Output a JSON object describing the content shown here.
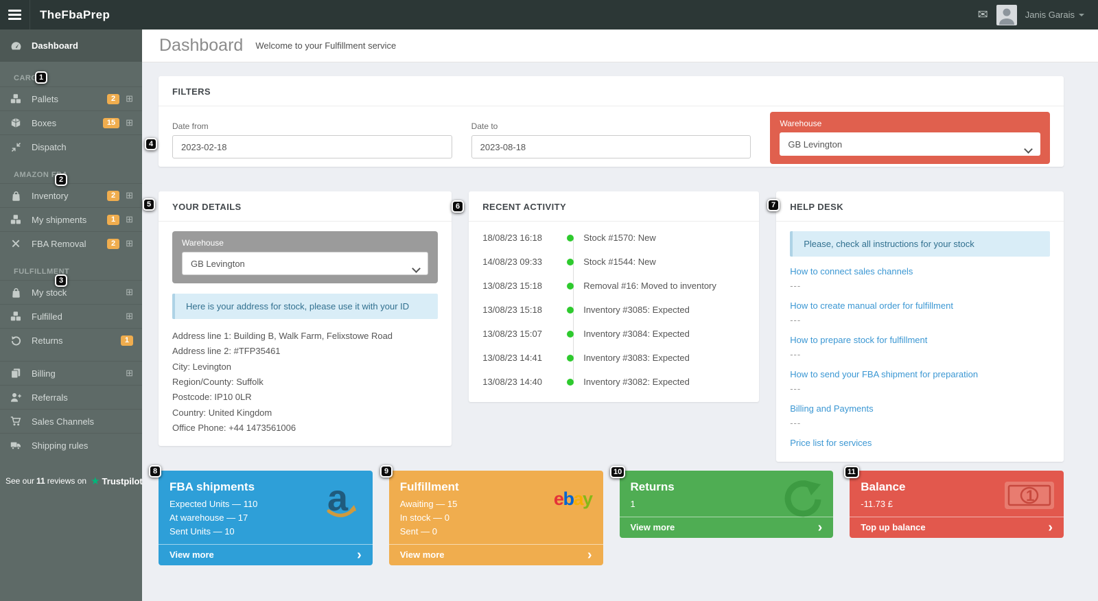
{
  "topbar": {
    "logo": "TheFbaPrep",
    "user_name": "Janis Garais"
  },
  "sidebar": {
    "dashboard_label": "Dashboard",
    "sections": [
      {
        "label": "CARGO",
        "items": [
          {
            "label": "Pallets",
            "badge": "2",
            "expand": "⊞"
          },
          {
            "label": "Boxes",
            "badge": "15",
            "expand": "⊞"
          },
          {
            "label": "Dispatch"
          }
        ]
      },
      {
        "label": "AMAZON FBA",
        "items": [
          {
            "label": "Inventory",
            "badge": "2",
            "expand": "⊞"
          },
          {
            "label": "My shipments",
            "badge": "1",
            "expand": "⊞"
          },
          {
            "label": "FBA Removal",
            "badge": "2",
            "expand": "⊞"
          }
        ]
      },
      {
        "label": "FULFILLMENT",
        "items": [
          {
            "label": "My stock",
            "expand": "⊞"
          },
          {
            "label": "Fulfilled",
            "expand": "⊞"
          },
          {
            "label": "Returns",
            "badge": "1"
          }
        ]
      },
      {
        "label": "",
        "items": [
          {
            "label": "Billing",
            "expand": "⊞"
          },
          {
            "label": "Referrals"
          },
          {
            "label": "Sales Channels"
          },
          {
            "label": "Shipping rules"
          }
        ]
      }
    ],
    "trustpilot_prefix": "See our",
    "trustpilot_count": "11",
    "trustpilot_suffix": "reviews on",
    "trustpilot_brand": "Trustpilot",
    "trustpilot_star": "★"
  },
  "page_header": {
    "title": "Dashboard",
    "subtitle": "Welcome to your Fulfillment service"
  },
  "filters": {
    "title": "FILTERS",
    "date_from_label": "Date from",
    "date_from_value": "2023-02-18",
    "date_to_label": "Date to",
    "date_to_value": "2023-08-18",
    "warehouse_label": "Warehouse",
    "warehouse_value": "GB Levington"
  },
  "your_details": {
    "title": "YOUR DETAILS",
    "warehouse_label": "Warehouse",
    "warehouse_value": "GB Levington",
    "alert": "Here is your address for stock, please use it with your ID",
    "address_lines": [
      "Address line 1: Building B, Walk Farm, Felixstowe Road",
      "Address line 2: #TFP35461",
      "City: Levington",
      "Region/County: Suffolk",
      "Postcode: IP10 0LR",
      "Country: United Kingdom",
      "Office Phone: +44 1473561006"
    ]
  },
  "recent_activity": {
    "title": "RECENT ACTIVITY",
    "events": [
      {
        "time": "18/08/23 16:18",
        "text": "Stock #1570: New"
      },
      {
        "time": "14/08/23 09:33",
        "text": "Stock #1544: New"
      },
      {
        "time": "13/08/23 15:18",
        "text": "Removal #16: Moved to inventory"
      },
      {
        "time": "13/08/23 15:18",
        "text": "Inventory #3085: Expected"
      },
      {
        "time": "13/08/23 15:07",
        "text": "Inventory #3084: Expected"
      },
      {
        "time": "13/08/23 14:41",
        "text": "Inventory #3083: Expected"
      },
      {
        "time": "13/08/23 14:40",
        "text": "Inventory #3082: Expected"
      }
    ]
  },
  "help_desk": {
    "title": "HELP DESK",
    "alert": "Please, check all instructions for your stock",
    "separator": "---",
    "links": [
      "How to connect sales channels",
      "How to create manual order for fulfillment",
      "How to prepare stock for fulfillment",
      "How to send your FBA shipment for preparation",
      "Billing and Payments",
      "Price list for services"
    ]
  },
  "cards": [
    {
      "title": "FBA shipments",
      "color": "#2e9fd8",
      "logo": "amazon",
      "lines": [
        "Expected Units — 110",
        "At warehouse — 17",
        "Sent Units — 10"
      ],
      "footer": "View more"
    },
    {
      "title": "Fulfillment",
      "color": "#f0ad4e",
      "logo": "ebay",
      "lines": [
        "Awaiting — 15",
        "In stock — 0",
        "Sent — 0"
      ],
      "footer": "View more"
    },
    {
      "title": "Returns",
      "color": "#4fad53",
      "logo": "return-arrow",
      "lines": [
        "1"
      ],
      "footer": "View more"
    },
    {
      "title": "Balance",
      "color": "#e2584d",
      "logo": "banknote",
      "lines": [
        "-11.73 £"
      ],
      "footer": "Top up balance"
    }
  ],
  "ebay_letters": [
    "e",
    "b",
    "a",
    "y"
  ],
  "markers": [
    "1",
    "2",
    "3",
    "4",
    "5",
    "6",
    "7",
    "8",
    "9",
    "10",
    "11"
  ],
  "colors": {
    "topbar": "#2c3736",
    "sidebar": "#5e6a67",
    "sidebar_active": "#4d5855",
    "badge_orange": "#f0ad4e",
    "warehouse_filter_red": "#e0604e",
    "alert_blue_bg": "#d9edf7",
    "alert_blue_text": "#31708f",
    "link_blue": "#3b97d3",
    "activity_dot_green": "#2eca2e",
    "card_blue": "#2e9fd8",
    "card_orange": "#f0ad4e",
    "card_green": "#4fad53",
    "card_red": "#e2584d",
    "trustpilot_green": "#00b67a",
    "ebay_letter_colors": [
      "#e53238",
      "#0064d2",
      "#f5af02",
      "#86b817"
    ]
  }
}
